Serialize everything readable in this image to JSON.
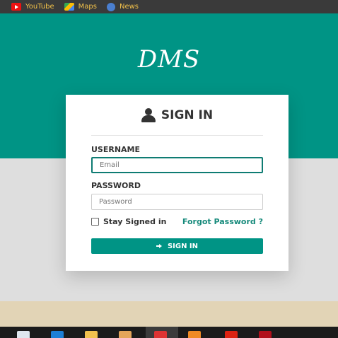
{
  "bookmarks": [
    {
      "label": "YouTube",
      "icon": "youtube-icon"
    },
    {
      "label": "Maps",
      "icon": "maps-icon"
    },
    {
      "label": "News",
      "icon": "news-icon"
    }
  ],
  "brand": "DMS",
  "login": {
    "title": "SIGN IN",
    "username_label": "USERNAME",
    "email_placeholder": "Email",
    "password_label": "PASSWORD",
    "password_placeholder": "Password",
    "stay_signed_in": "Stay Signed in",
    "forgot_password": "Forgot Password ?",
    "submit_label": "SIGN IN"
  },
  "taskbar": {
    "apps": [
      "start-icon",
      "edge-icon",
      "file-explorer-icon",
      "app-icon",
      "chrome-icon",
      "sublime-icon",
      "pdf-icon",
      "mcafee-icon"
    ]
  },
  "colors": {
    "accent": "#009485",
    "background_lower": "#dedede",
    "link": "#168a7b"
  }
}
